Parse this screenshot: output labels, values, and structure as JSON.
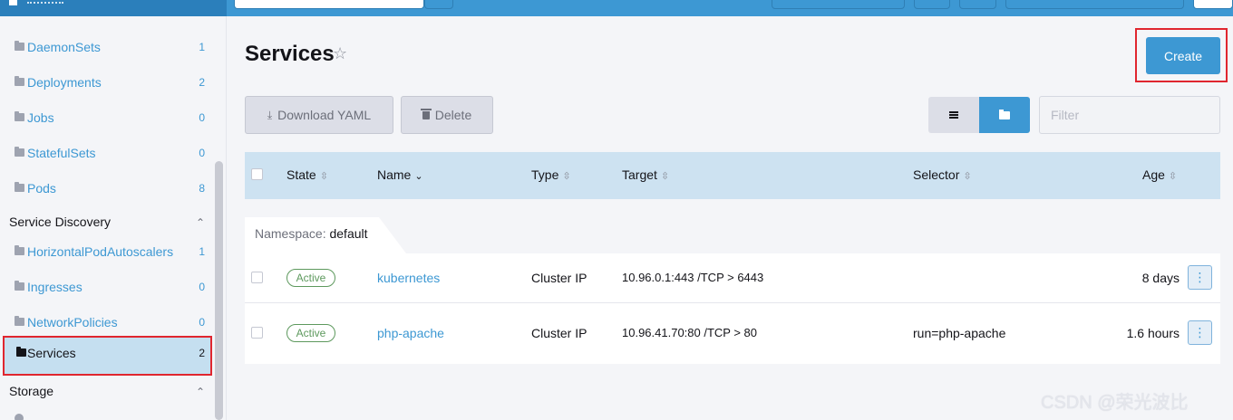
{
  "topbar": {},
  "sidebar": {
    "items_top": [
      {
        "label": "DaemonSets",
        "count": "1"
      },
      {
        "label": "Deployments",
        "count": "2"
      },
      {
        "label": "Jobs",
        "count": "0"
      },
      {
        "label": "StatefulSets",
        "count": "0"
      },
      {
        "label": "Pods",
        "count": "8"
      }
    ],
    "group_service": "Service Discovery",
    "items_service": [
      {
        "label": "HorizontalPodAutoscalers",
        "count": "1"
      },
      {
        "label": "Ingresses",
        "count": "0"
      },
      {
        "label": "NetworkPolicies",
        "count": "0"
      },
      {
        "label": "Services",
        "count": "2"
      }
    ],
    "group_storage": "Storage",
    "chevron": "⌃"
  },
  "page": {
    "title": "Services",
    "star": "☆"
  },
  "toolbar": {
    "create": "Create",
    "download_yaml": "Download YAML",
    "download_icon": "⤓",
    "delete": "Delete",
    "filter_placeholder": "Filter"
  },
  "table": {
    "headers": {
      "state": "State",
      "name": "Name",
      "type": "Type",
      "target": "Target",
      "selector": "Selector",
      "age": "Age"
    },
    "sort_glyph": "⇳",
    "sort_active_glyph": "⌄",
    "namespace_label": "Namespace:",
    "namespace_value": "default",
    "rows": [
      {
        "state": "Active",
        "name": "kubernetes",
        "type": "Cluster IP",
        "target": "10.96.0.1:443 /TCP > 6443",
        "selector": "",
        "age": "8 days"
      },
      {
        "state": "Active",
        "name": "php-apache",
        "type": "Cluster IP",
        "target": "10.96.41.70:80 /TCP > 80",
        "selector": "run=php-apache",
        "age": "1.6 hours"
      }
    ],
    "kebab": "⋮"
  },
  "watermark": "CSDN @荣光波比",
  "colors": {
    "accent": "#3d98d3",
    "header_bg": "#cde2f1",
    "highlight": "#e0262f",
    "active_badge": "#5d995d"
  }
}
